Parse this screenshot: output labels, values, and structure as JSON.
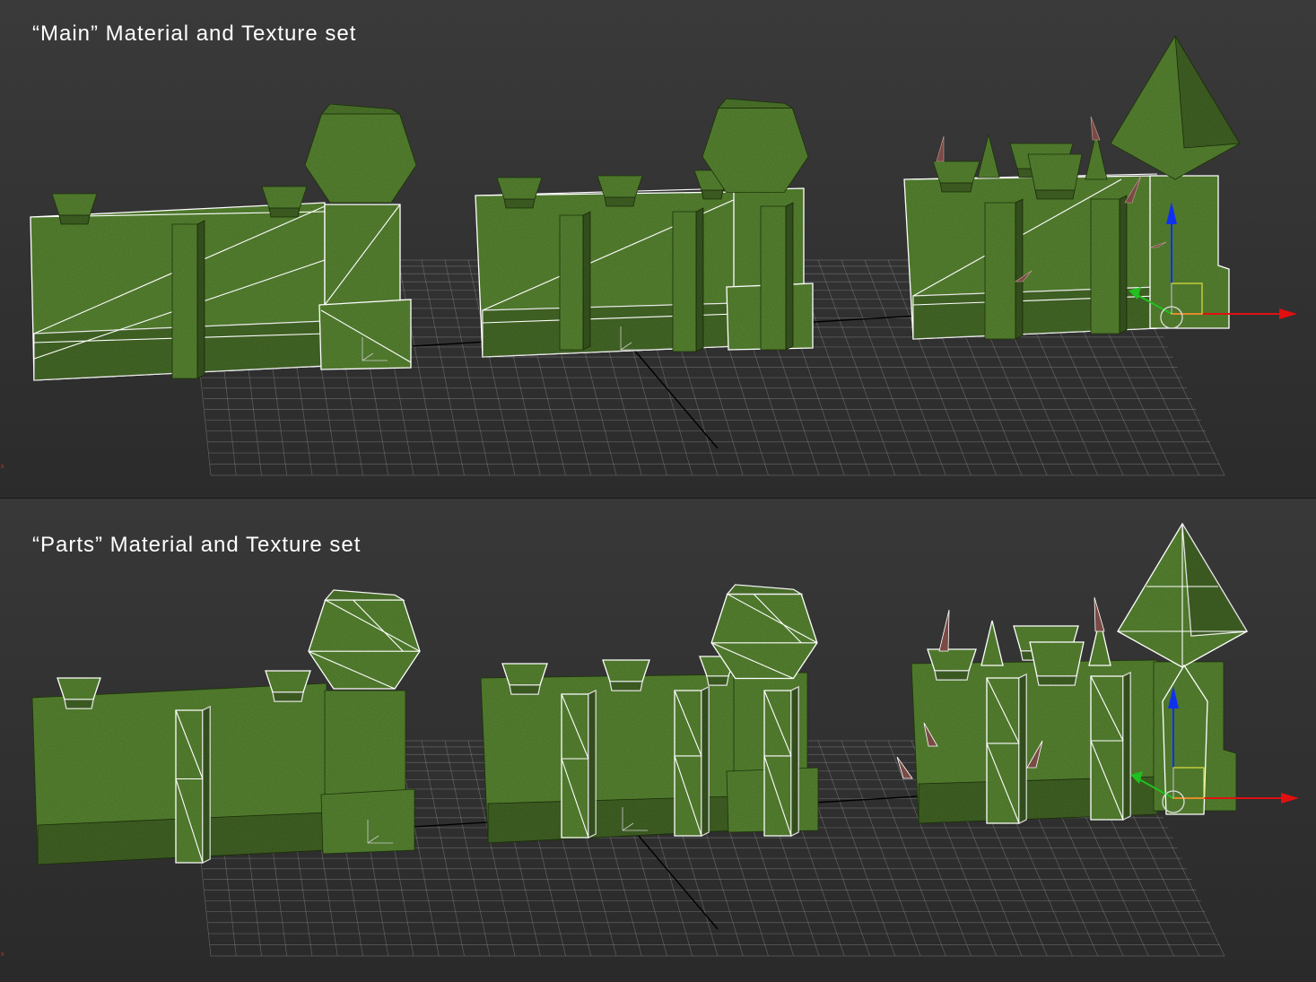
{
  "viewports": [
    {
      "title": "“Main” Material and Texture set",
      "render_mode": "smooth-shaded with edged faces on walls",
      "background_gradient": [
        "#444444",
        "#1f1f1f"
      ]
    },
    {
      "title": "“Parts” Material and Texture set",
      "render_mode": "smooth-shaded with edged faces on parts",
      "background_gradient": [
        "#3d3d3d",
        "#1f1f1f"
      ]
    }
  ],
  "objects": [
    {
      "name": "hedge-wall-segment-1"
    },
    {
      "name": "hedge-wall-segment-2"
    },
    {
      "name": "hedge-wall-segment-3-tower"
    }
  ],
  "colors": {
    "hedge_dark": "#2f4f16",
    "hedge_mid": "#3f6a1e",
    "hedge_light": "#5a8a2e",
    "wireframe": "#ffffff",
    "grid": "#8a8a8a",
    "gizmo_x": "#e01010",
    "gizmo_y": "#20c020",
    "gizmo_z": "#1030f0"
  },
  "icons": {
    "transform_gizmo": "move-gizmo-icon",
    "axis_tripod": "axis-tripod-icon"
  }
}
